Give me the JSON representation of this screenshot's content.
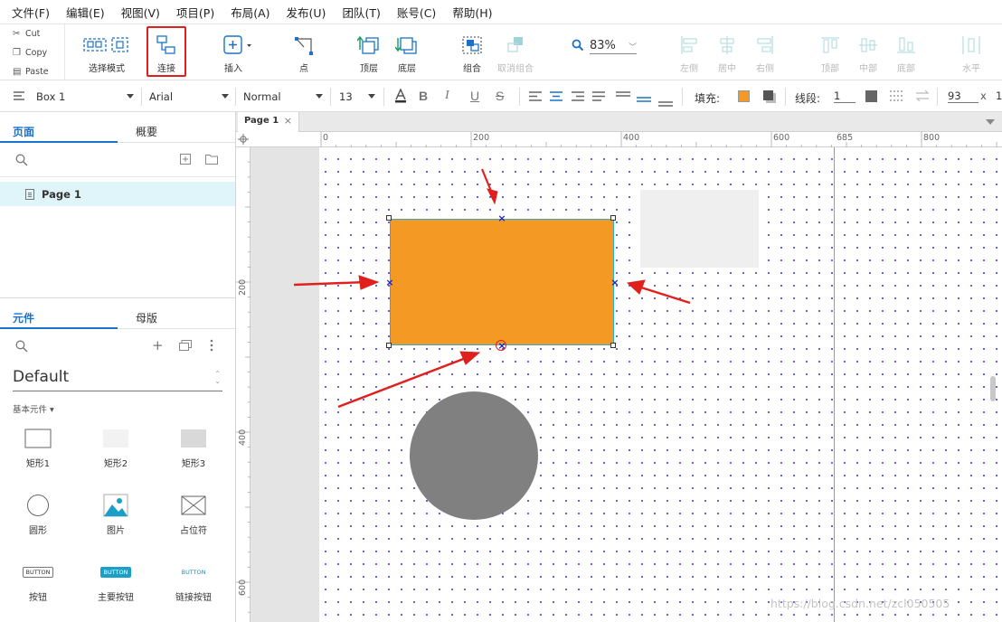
{
  "menu": [
    "文件(F)",
    "编辑(E)",
    "视图(V)",
    "项目(P)",
    "布局(A)",
    "发布(U)",
    "团队(T)",
    "账号(C)",
    "帮助(H)"
  ],
  "clipboard": {
    "cut": "Cut",
    "copy": "Copy",
    "paste": "Paste"
  },
  "toolbar": {
    "select_mode": "选择模式",
    "connect": "连接",
    "insert": "插入",
    "point": "点",
    "top_layer": "顶层",
    "bottom_layer": "底层",
    "group": "组合",
    "ungroup": "取消组合",
    "zoom": "83%",
    "align_left": "左侧",
    "align_center": "居中",
    "align_right": "右侧",
    "align_top": "顶部",
    "align_middle": "中部",
    "align_bottom": "底部",
    "distribute_h": "水平"
  },
  "stylebar": {
    "widget_name": "Box 1",
    "font_family": "Arial",
    "font_weight": "Normal",
    "font_size": "13",
    "fill_label": "填充:",
    "fill_color": "#f49a24",
    "stroke_label": "线段:",
    "stroke_width": "1",
    "x_value": "93",
    "x_unit": "x",
    "y_value_partial": "1"
  },
  "left_panel": {
    "tab_pages": "页面",
    "tab_outline": "概要",
    "pages": [
      "Page 1"
    ],
    "tab_widgets": "元件",
    "tab_masters": "母版",
    "library": "Default",
    "category": "基本元件 ▾",
    "widgets": [
      "矩形1",
      "矩形2",
      "矩形3",
      "圆形",
      "图片",
      "占位符",
      "按钮",
      "主要按钮",
      "链接按钮"
    ],
    "button_text": "BUTTON"
  },
  "canvas": {
    "doc_tab": "Page 1",
    "h_ruler": [
      "0",
      "200",
      "400",
      "600",
      "685",
      "800"
    ],
    "v_ruler": [
      "200",
      "400",
      "600"
    ],
    "box_fill": "#f49a24",
    "box_border": "#27b2c6",
    "circle_fill": "#808080",
    "annotation_color": "#e0201c"
  },
  "watermark": "https://blog.csdn.net/zcl050505"
}
